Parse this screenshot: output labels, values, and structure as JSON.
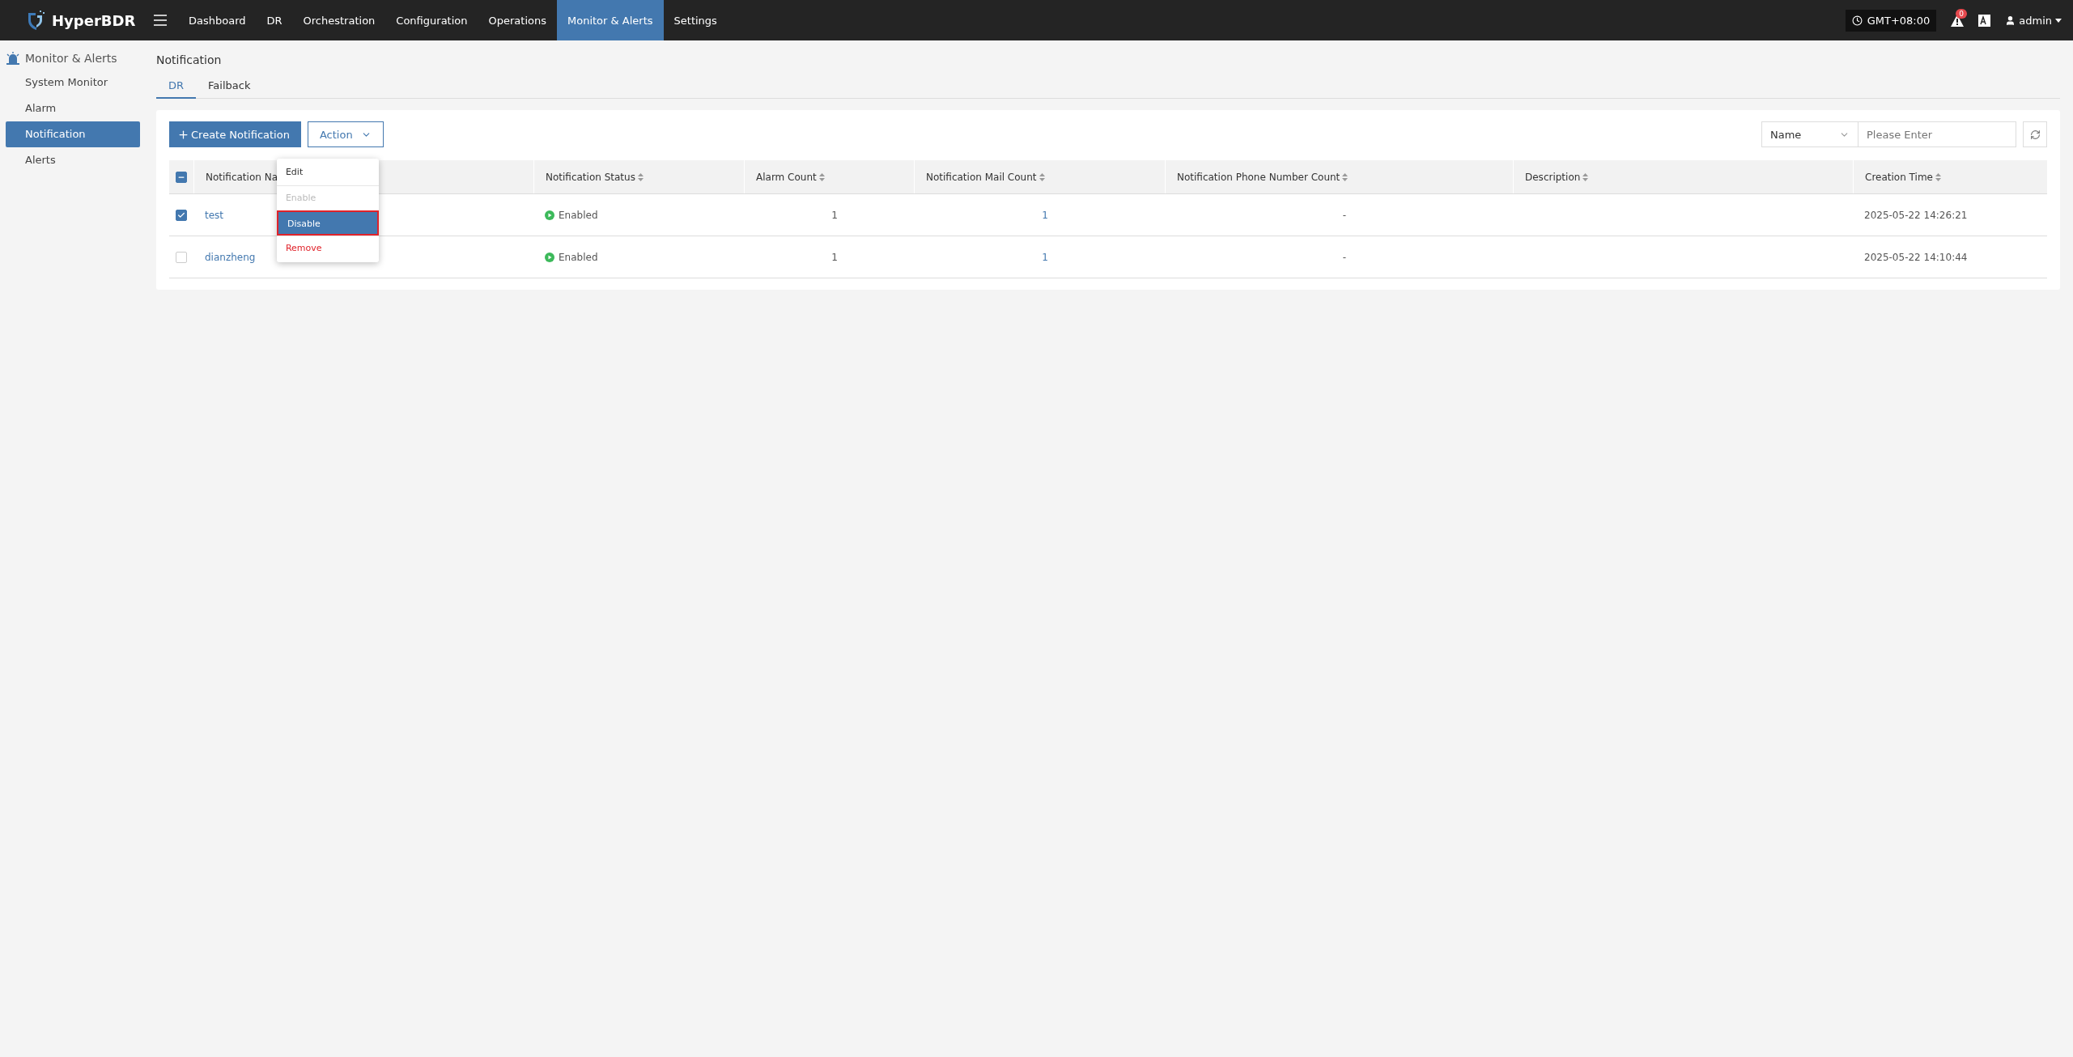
{
  "app": {
    "brand": "HyperBDR",
    "timezone": "GMT+08:00",
    "alert_count": "0",
    "user": "admin",
    "nav": [
      {
        "label": "Dashboard",
        "selected": false
      },
      {
        "label": "DR",
        "selected": false
      },
      {
        "label": "Orchestration",
        "selected": false
      },
      {
        "label": "Configuration",
        "selected": false
      },
      {
        "label": "Operations",
        "selected": false
      },
      {
        "label": "Monitor & Alerts",
        "selected": true
      },
      {
        "label": "Settings",
        "selected": false
      }
    ]
  },
  "sidebar": {
    "title": "Monitor & Alerts",
    "items": [
      {
        "label": "System Monitor",
        "selected": false
      },
      {
        "label": "Alarm",
        "selected": false
      },
      {
        "label": "Notification",
        "selected": true
      },
      {
        "label": "Alerts",
        "selected": false
      }
    ]
  },
  "page": {
    "title": "Notification",
    "tabs": [
      {
        "label": "DR",
        "selected": true
      },
      {
        "label": "Failback",
        "selected": false
      }
    ]
  },
  "toolbar": {
    "create_button": "Create Notification",
    "action_button": "Action",
    "action_menu": [
      {
        "label": "Edit",
        "kind": "normal",
        "disabled": false,
        "selected": false
      },
      {
        "label": "Enable",
        "kind": "normal",
        "disabled": true,
        "selected": false
      },
      {
        "label": "Disable",
        "kind": "normal",
        "disabled": false,
        "selected": true
      },
      {
        "label": "Remove",
        "kind": "danger",
        "disabled": false,
        "selected": false
      }
    ],
    "search": {
      "field": "Name",
      "placeholder": "Please Enter"
    }
  },
  "table": {
    "select_all": {
      "indeterminate": true
    },
    "columns": [
      {
        "label": "Notification Na"
      },
      {
        "label": "Notification Status"
      },
      {
        "label": "Alarm Count"
      },
      {
        "label": "Notification Mail Count"
      },
      {
        "label": "Notification Phone Number Count"
      },
      {
        "label": "Description"
      },
      {
        "label": "Creation Time"
      }
    ],
    "rows": [
      {
        "checked": true,
        "name": "test",
        "status": "Enabled",
        "alarm_count": "1",
        "mail_count": "1",
        "phone_count": "-",
        "created": "2025-05-22 14:26:21"
      },
      {
        "checked": false,
        "name": "dianzheng",
        "status": "Enabled",
        "alarm_count": "1",
        "mail_count": "1",
        "phone_count": "-",
        "created": "2025-05-22 14:10:44"
      }
    ]
  }
}
